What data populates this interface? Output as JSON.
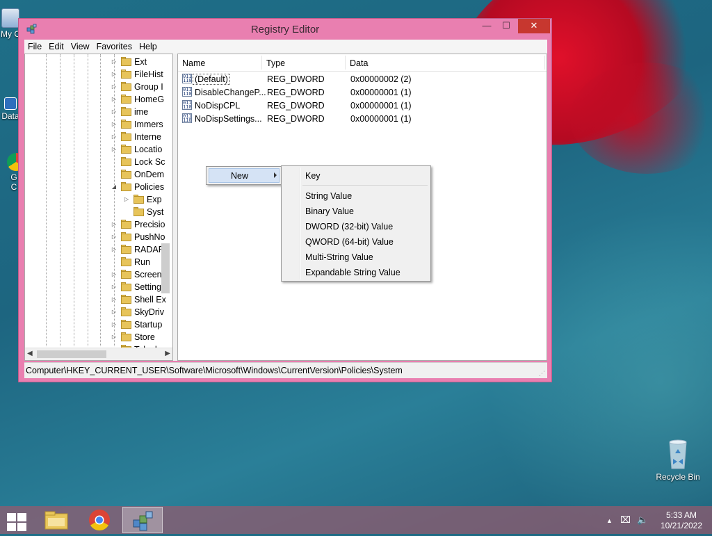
{
  "window": {
    "title": "Registry Editor",
    "minimize_glyph": "—",
    "maximize_glyph": "☐",
    "close_glyph": "✕"
  },
  "menubar": [
    "File",
    "Edit",
    "View",
    "Favorites",
    "Help"
  ],
  "desktop_icons": [
    {
      "label": "My C",
      "icon": "computer-icon"
    },
    {
      "label": "Data",
      "icon": "shortcut-icon"
    },
    {
      "label": "G\nC",
      "icon": "chrome-icon"
    }
  ],
  "tree": {
    "items": [
      {
        "label": "Ext",
        "expander": "▷"
      },
      {
        "label": "FileHist",
        "expander": "▷"
      },
      {
        "label": "Group I",
        "expander": "▷"
      },
      {
        "label": "HomeG",
        "expander": "▷"
      },
      {
        "label": "ime",
        "expander": "▷"
      },
      {
        "label": "Immers",
        "expander": "▷"
      },
      {
        "label": "Interne",
        "expander": "▷"
      },
      {
        "label": "Locatio",
        "expander": "▷"
      },
      {
        "label": "Lock Sc",
        "expander": ""
      },
      {
        "label": "OnDem",
        "expander": ""
      },
      {
        "label": "Policies",
        "expander": "◢"
      },
      {
        "label": "Exp",
        "expander": "▷",
        "child": true
      },
      {
        "label": "Syst",
        "expander": "",
        "child": true
      },
      {
        "label": "Precisio",
        "expander": "▷"
      },
      {
        "label": "PushNo",
        "expander": "▷"
      },
      {
        "label": "RADAR",
        "expander": "▷"
      },
      {
        "label": "Run",
        "expander": ""
      },
      {
        "label": "Screens",
        "expander": "▷"
      },
      {
        "label": "Setting",
        "expander": "▷"
      },
      {
        "label": "Shell Ex",
        "expander": "▷"
      },
      {
        "label": "SkyDriv",
        "expander": "▷"
      },
      {
        "label": "Startup",
        "expander": "▷"
      },
      {
        "label": "Store",
        "expander": "▷"
      },
      {
        "label": "Teleph",
        "expander": "▷"
      }
    ],
    "scroll_left": "◀",
    "scroll_right": "▶"
  },
  "list": {
    "headers": {
      "name": "Name",
      "type": "Type",
      "data": "Data"
    },
    "rows": [
      {
        "name": "(Default)",
        "type": "REG_DWORD",
        "data": "0x00000002 (2)"
      },
      {
        "name": "DisableChangeP...",
        "type": "REG_DWORD",
        "data": "0x00000001 (1)"
      },
      {
        "name": "NoDispCPL",
        "type": "REG_DWORD",
        "data": "0x00000001 (1)"
      },
      {
        "name": "NoDispSettings...",
        "type": "REG_DWORD",
        "data": "0x00000001 (1)"
      }
    ],
    "reg_icon_text": "011\n110"
  },
  "statusbar": {
    "path": "Computer\\HKEY_CURRENT_USER\\Software\\Microsoft\\Windows\\CurrentVersion\\Policies\\System"
  },
  "context_menu": {
    "new_label": "New",
    "submenu": {
      "key": "Key",
      "items": [
        "String Value",
        "Binary Value",
        "DWORD (32-bit) Value",
        "QWORD (64-bit) Value",
        "Multi-String Value",
        "Expandable String Value"
      ]
    }
  },
  "recycle_bin": {
    "label": "Recycle Bin"
  },
  "taskbar": {
    "apps": [
      "file-explorer-icon",
      "chrome-icon",
      "regedit-icon"
    ],
    "tray_arrow": "▲",
    "tray_network": "⌧",
    "tray_volume": "🔈",
    "time": "5:33 AM",
    "date": "10/21/2022"
  },
  "colors": {
    "window_frame": "#e97fb0",
    "close_button": "#c7372f",
    "menu_highlight": "#d5e3f5",
    "taskbar": "#96596e"
  }
}
